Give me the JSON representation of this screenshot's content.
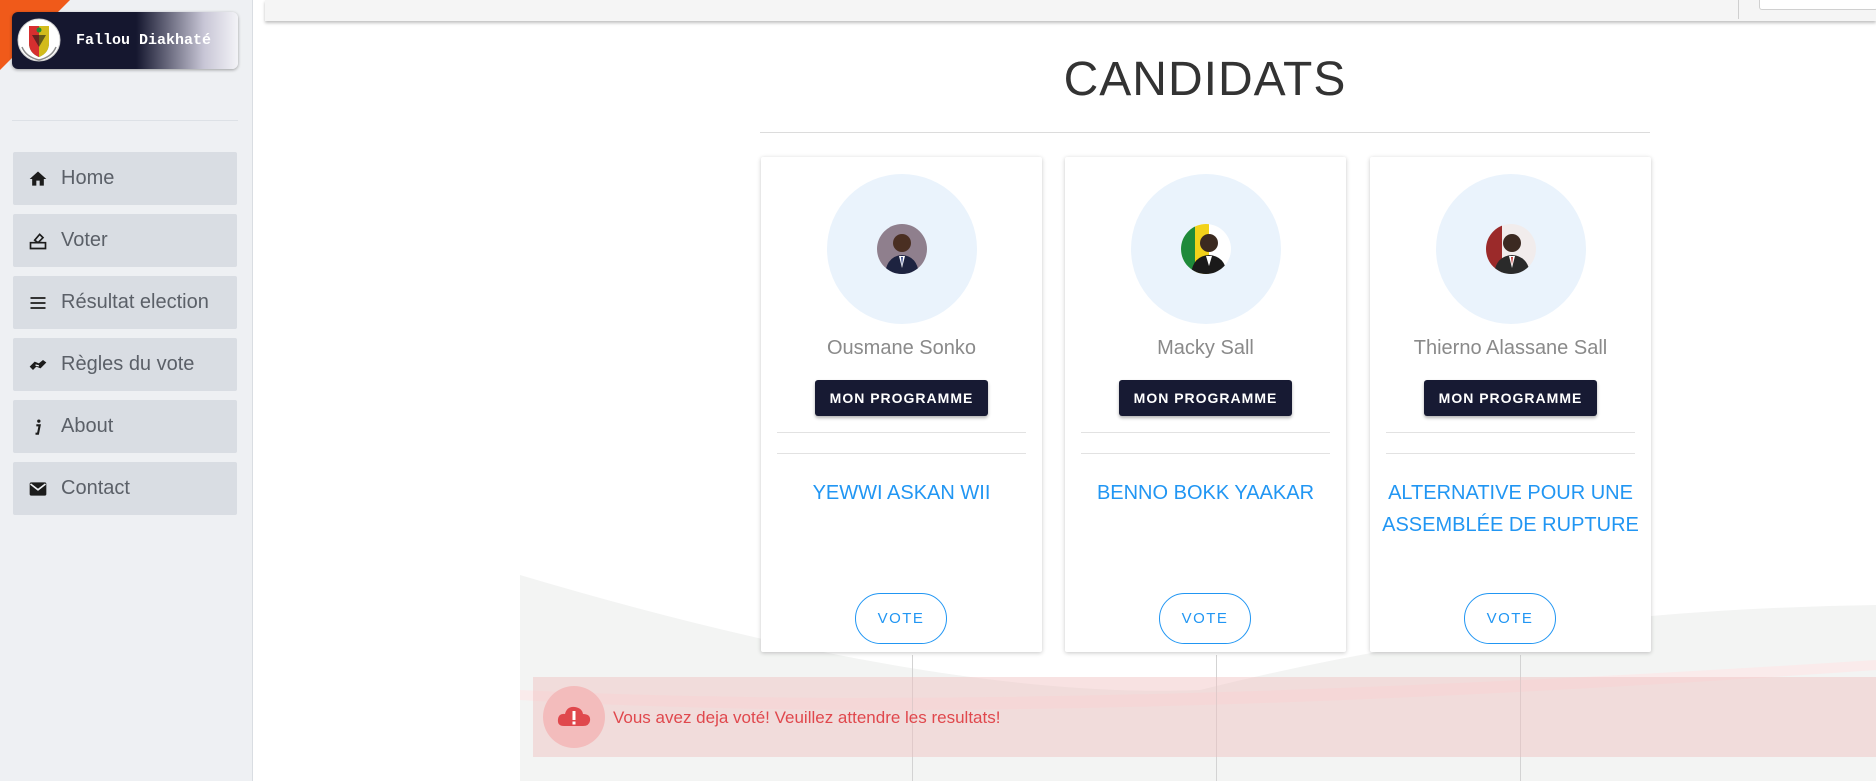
{
  "sidebar": {
    "brand_name": "Fallou Diakhaté",
    "items": [
      {
        "label": "Home",
        "icon": "home-icon"
      },
      {
        "label": "Voter",
        "icon": "ballot-icon"
      },
      {
        "label": "Résultat election",
        "icon": "list-icon"
      },
      {
        "label": "Règles du vote",
        "icon": "handshake-icon"
      },
      {
        "label": "About",
        "icon": "info-icon"
      },
      {
        "label": "Contact",
        "icon": "mail-icon"
      }
    ]
  },
  "main": {
    "title": "CANDIDATS",
    "candidates": [
      {
        "name": "Ousmane Sonko",
        "program_label": "MON PROGRAMME",
        "party_line1": "YEWWI ASKAN WII",
        "party_line2": "",
        "vote_label": "VOTE"
      },
      {
        "name": "Macky Sall",
        "program_label": "MON PROGRAMME",
        "party_line1": "BENNO BOKK YAAKAR",
        "party_line2": "",
        "vote_label": "VOTE"
      },
      {
        "name": "Thierno Alassane Sall",
        "program_label": "MON PROGRAMME",
        "party_line1": "ALTERNATIVE POUR UNE",
        "party_line2": "ASSEMBLÉE DE RUPTURE",
        "vote_label": "VOTE"
      }
    ],
    "alert": {
      "message": "Vous avez deja voté! Veuillez attendre les resultats!",
      "icon": "cloud-alert-icon"
    }
  },
  "colors": {
    "brand_dark": "#15172f",
    "accent_orange": "#f05a1a",
    "link_blue": "#2196f3",
    "alert_red": "#e0484d"
  }
}
